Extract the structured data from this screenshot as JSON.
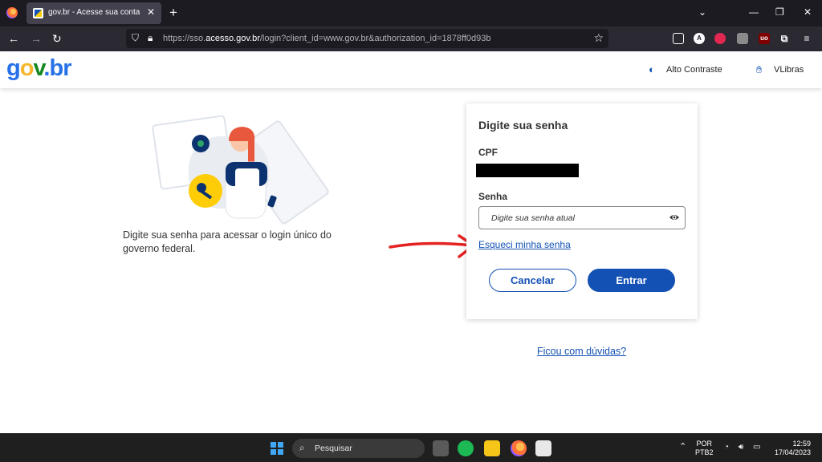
{
  "browser": {
    "tab_title": "gov.br - Acesse sua conta",
    "tab_close": "✕",
    "new_tab": "+",
    "url_prefix": "https://sso.",
    "url_host": "acesso.gov.br",
    "url_rest": "/login?client_id=www.gov.br&authorization_id=1878ff0d93b",
    "icons": [
      "firefox-icon",
      "back-icon",
      "forward-icon",
      "reload-icon",
      "shield-icon",
      "lock-icon",
      "star-icon",
      "pocket-icon",
      "extension-icon"
    ]
  },
  "header": {
    "logo_parts": [
      "g",
      "o",
      "v",
      ".br"
    ],
    "contrast_label": "Alto Contraste",
    "vlibras_label": "VLibras"
  },
  "left": {
    "description": "Digite sua senha para acessar o login único do governo federal."
  },
  "login": {
    "title": "Digite sua senha",
    "cpf_label": "CPF",
    "password_label": "Senha",
    "password_placeholder": "Digite sua senha atual",
    "forgot_link": "Esqueci minha senha",
    "cancel_button": "Cancelar",
    "enter_button": "Entrar"
  },
  "help_link": "Ficou com dúvidas?",
  "taskbar": {
    "search_placeholder": "Pesquisar",
    "lang_1": "POR",
    "lang_2": "PTB2",
    "time": "12:59",
    "date": "17/04/2023"
  },
  "colors": {
    "primary": "#1351b4",
    "arrow": "#e52222"
  }
}
